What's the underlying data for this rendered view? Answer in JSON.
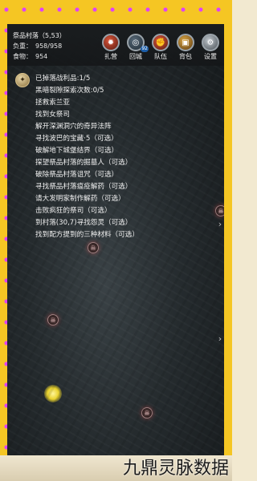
{
  "status": {
    "location_name": "祭品村落（5,53）",
    "load_label": "负重：",
    "load_value": "958/958",
    "food_label": "食物：",
    "food_value": "954"
  },
  "nav": [
    {
      "label": "扎营",
      "icon": "flame-icon"
    },
    {
      "label": "回城",
      "icon": "portal-icon",
      "badge": "92"
    },
    {
      "label": "队伍",
      "icon": "fist-icon"
    },
    {
      "label": "背包",
      "icon": "bag-icon"
    },
    {
      "label": "设置",
      "icon": "gear-icon"
    }
  ],
  "quests": [
    "已掉落战利品:1/5",
    "黑暗裂隙探索次数:0/5",
    "拯救索兰亚",
    "找到女祭司",
    "解开深渊洞穴的奇异法阵",
    "寻找波巴的宝藏·5（可选）",
    "破解地下城堡结界（可选）",
    "探望祭品村落的掘墓人（可选）",
    "破除祭品村落诅咒（可选）",
    "寻找祭品村落瘟疫解药（可选）",
    "请大发明家制作解药（可选）",
    "击败疯狂的祭司（可选）",
    "到村落(30,7)寻找怨灵（可选）",
    "找到配方提到的三种材料（可选）"
  ],
  "watermark": "九鼎灵脉数据",
  "colors": {
    "frame": "#f5c623",
    "dots": "#e040fb"
  }
}
